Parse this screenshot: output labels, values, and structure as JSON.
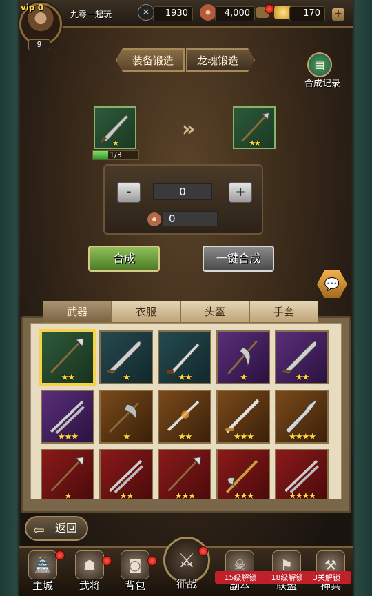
{
  "player": {
    "vip_label": "vip 0",
    "name": "九零一起玩",
    "level": "9"
  },
  "resources": {
    "sword_power": "1930",
    "copper": "4,000",
    "gold": "170",
    "add_label": "+"
  },
  "forge_tabs": [
    "装备锻造",
    "龙魂锻造"
  ],
  "record_label": "合成记录",
  "source_item": {
    "stars": "★",
    "progress": "1/3",
    "progress_fraction": 0.333
  },
  "target_item": {
    "stars": "★★"
  },
  "quantity": {
    "minus": "-",
    "value": "0",
    "plus": "+"
  },
  "cost": {
    "value": "0"
  },
  "buttons": {
    "synthesize": "合成",
    "one_click": "一键合成"
  },
  "inventory_tabs": [
    "武器",
    "衣服",
    "头盔",
    "手套"
  ],
  "inventory": [
    {
      "color": "green",
      "stars": "★★",
      "weapon": "spear"
    },
    {
      "color": "teal",
      "stars": "★",
      "weapon": "sabre"
    },
    {
      "color": "teal",
      "stars": "★★",
      "weapon": "dagger"
    },
    {
      "color": "purple",
      "stars": "★",
      "weapon": "halberd"
    },
    {
      "color": "purple",
      "stars": "★★",
      "weapon": "sabre"
    },
    {
      "color": "purple",
      "stars": "★★★",
      "weapon": "twin-swords"
    },
    {
      "color": "orange",
      "stars": "★",
      "weapon": "axe"
    },
    {
      "color": "orange",
      "stars": "★★",
      "weapon": "swords"
    },
    {
      "color": "orange",
      "stars": "★★★",
      "weapon": "sword"
    },
    {
      "color": "orange",
      "stars": "★★★★",
      "weapon": "flame-blade"
    },
    {
      "color": "red",
      "stars": "★",
      "weapon": "spear"
    },
    {
      "color": "red",
      "stars": "★★",
      "weapon": "twin-swords"
    },
    {
      "color": "red",
      "stars": "★★★",
      "weapon": "spear"
    },
    {
      "color": "red",
      "stars": "★★★",
      "weapon": "dragon-blade"
    },
    {
      "color": "red",
      "stars": "★★★★",
      "weapon": "twin-swords"
    }
  ],
  "back_label": "返回",
  "nav": [
    {
      "label": "主城",
      "icon": "castle-icon",
      "lock": ""
    },
    {
      "label": "武将",
      "icon": "general-icon",
      "lock": ""
    },
    {
      "label": "背包",
      "icon": "bag-icon",
      "lock": ""
    },
    {
      "label": "征战",
      "icon": "crossed-swords-icon",
      "lock": ""
    },
    {
      "label": "副本",
      "icon": "skull-icon",
      "lock": "15级解锁"
    },
    {
      "label": "联盟",
      "icon": "banner-icon",
      "lock": "18级解锁"
    },
    {
      "label": "神兵",
      "icon": "divine-weapon-icon",
      "lock": "3关解锁"
    }
  ]
}
